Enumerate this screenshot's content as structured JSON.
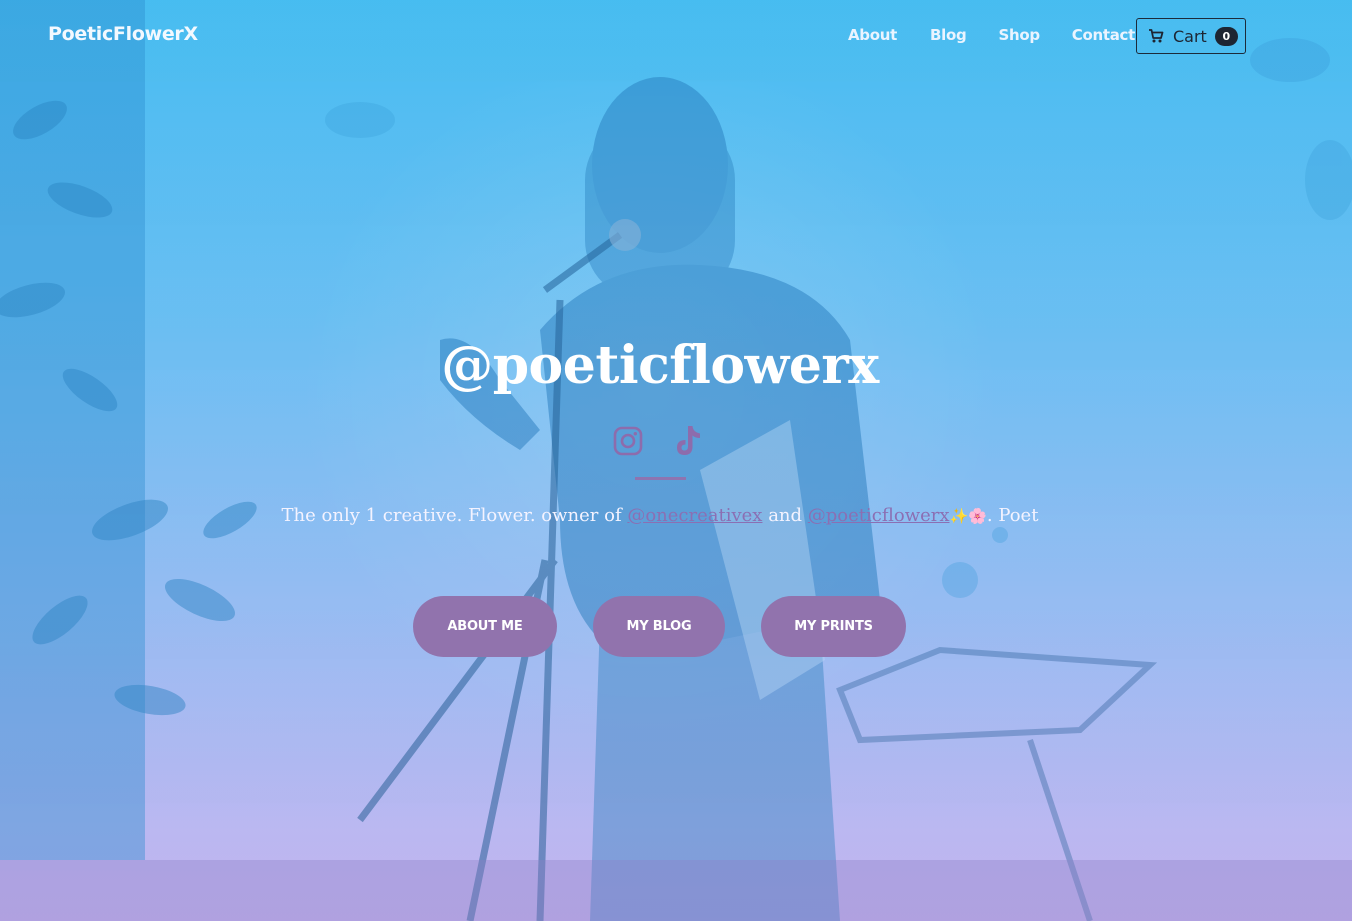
{
  "colors": {
    "gradient_top": "#4cc4f6",
    "gradient_bottom": "#cbbcf3",
    "accent_purple": "#9173ad",
    "link_purple": "#8b6fb3",
    "icon_purple": "#8d6cac",
    "cart_dark": "#1d2532"
  },
  "brand": {
    "name": "PoeticFlowerX"
  },
  "nav": {
    "items": [
      {
        "label": "About"
      },
      {
        "label": "Blog"
      },
      {
        "label": "Shop"
      },
      {
        "label": "Contact"
      }
    ]
  },
  "cart": {
    "label": "Cart",
    "count": "0",
    "icon": "cart-icon"
  },
  "hero": {
    "headline": "@poeticflowerx",
    "social_icons": [
      "instagram-icon",
      "tiktok-icon"
    ],
    "tagline": {
      "part1": "The only 1 creative. Flower. owner of ",
      "link1": "@onecreativex",
      "part2": " and ",
      "link2": "@poeticflowerx",
      "emojis": "✨🌸",
      "part3": ". Poet"
    },
    "buttons": [
      {
        "label": "ABOUT ME"
      },
      {
        "label": "MY BLOG"
      },
      {
        "label": "MY PRINTS"
      }
    ]
  }
}
